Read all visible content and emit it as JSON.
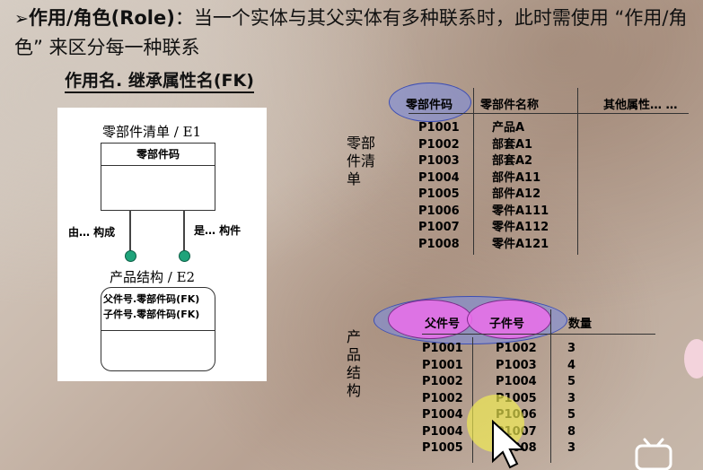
{
  "heading": {
    "bullet": "➢",
    "bold": "作用/角色(Role)",
    "text": "：当一个实体与其父实体有多种联系时，此时需使用 “作用/角色” 来区分每一种联系"
  },
  "subtitle": "作用名. 继承属性名(FK)",
  "diagram": {
    "e1_title": "零部件清单 / E1",
    "e1_key": "零部件码",
    "rel_left": "由… 构成",
    "rel_right": "是… 构件",
    "e2_title": "产品结构 / E2",
    "e2_attrs": [
      "父件号.零部件码(FK)",
      "子件号.零部件码(FK)"
    ]
  },
  "table1": {
    "side_label": "零部件清单",
    "headers": [
      "零部件码",
      "零部件名称",
      "其他属性…  …"
    ],
    "rows": [
      [
        "P1001",
        "产品A"
      ],
      [
        "P1002",
        "部套A1"
      ],
      [
        "P1003",
        "部套A2"
      ],
      [
        "P1004",
        "部件A11"
      ],
      [
        "P1005",
        "部件A12"
      ],
      [
        "P1006",
        "零件A111"
      ],
      [
        "P1007",
        "零件A112"
      ],
      [
        "P1008",
        "零件A121"
      ]
    ]
  },
  "table2": {
    "side_label": "产品结构",
    "headers": [
      "父件号",
      "子件号",
      "数量"
    ],
    "rows": [
      [
        "P1001",
        "P1002",
        "3"
      ],
      [
        "P1001",
        "P1003",
        "4"
      ],
      [
        "P1002",
        "P1004",
        "5"
      ],
      [
        "P1002",
        "P1005",
        "3"
      ],
      [
        "P1004",
        "P1006",
        "5"
      ],
      [
        "P1004",
        "P1007",
        "8"
      ],
      [
        "P1005",
        "P1008",
        "3"
      ]
    ]
  },
  "colors": {
    "key_oval_blue": "#7f8fe6",
    "key_oval_pink": "#eb6eeb",
    "connector_green": "#1fa37a"
  }
}
